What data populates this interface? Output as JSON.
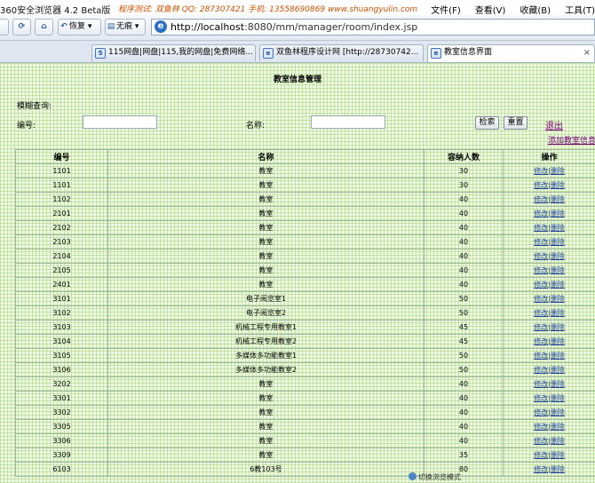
{
  "titlebar": {
    "app_title": "360安全浏览器 4.2 Beta版",
    "promo": "程序测试: 双鱼林   QQ: 287307421   手机: 13558690869   www.shuangyulin.com",
    "menus": [
      "文件(F)",
      "查看(V)",
      "收藏(B)",
      "工具(T)"
    ]
  },
  "toolbar": {
    "back_label": "恢复",
    "nopic_label": "无痕",
    "address": "http://localhost:8080/mm/manager/room/index.jsp",
    "address_host": "http://localhost",
    "address_rest": ":8080/mm/manager/room/index.jsp"
  },
  "tabs": [
    {
      "label": "115网盘|网盘|115,我的网盘|免费网络..."
    },
    {
      "label": "双鱼林程序设计网 [http://28730742..."
    },
    {
      "label": "教室信息界面"
    }
  ],
  "page": {
    "title": "教室信息管理",
    "fuzzy_label": "模糊查询:",
    "id_label": "编号:",
    "name_label": "名称:",
    "search_button": "检索",
    "reset_button": "重置",
    "logout": "退出",
    "add_link": "添加教室信息"
  },
  "table": {
    "headers": [
      "编号",
      "名称",
      "容纳人数",
      "操作"
    ],
    "edit_label": "修改",
    "sep": "|",
    "delete_label": "删除",
    "rows": [
      [
        "1101",
        "教室",
        "30"
      ],
      [
        "1101",
        "教室",
        "30"
      ],
      [
        "1102",
        "教室",
        "40"
      ],
      [
        "2101",
        "教室",
        "40"
      ],
      [
        "2102",
        "教室",
        "40"
      ],
      [
        "2103",
        "教室",
        "40"
      ],
      [
        "2104",
        "教室",
        "40"
      ],
      [
        "2105",
        "教室",
        "40"
      ],
      [
        "2401",
        "教室",
        "40"
      ],
      [
        "3101",
        "电子阅览室1",
        "50"
      ],
      [
        "3102",
        "电子阅览室2",
        "50"
      ],
      [
        "3103",
        "机械工程专用教室1",
        "45"
      ],
      [
        "3104",
        "机械工程专用教室2",
        "45"
      ],
      [
        "3105",
        "多媒体多功能教室1",
        "50"
      ],
      [
        "3106",
        "多媒体多功能教室2",
        "50"
      ],
      [
        "3202",
        "教室",
        "40"
      ],
      [
        "3301",
        "教室",
        "40"
      ],
      [
        "3302",
        "教室",
        "40"
      ],
      [
        "3305",
        "教室",
        "40"
      ],
      [
        "3306",
        "教室",
        "40"
      ],
      [
        "3309",
        "教室",
        "35"
      ],
      [
        "6103",
        "6教103号",
        "80"
      ]
    ]
  },
  "statusbar": {
    "mode": "切换浏览模式"
  }
}
